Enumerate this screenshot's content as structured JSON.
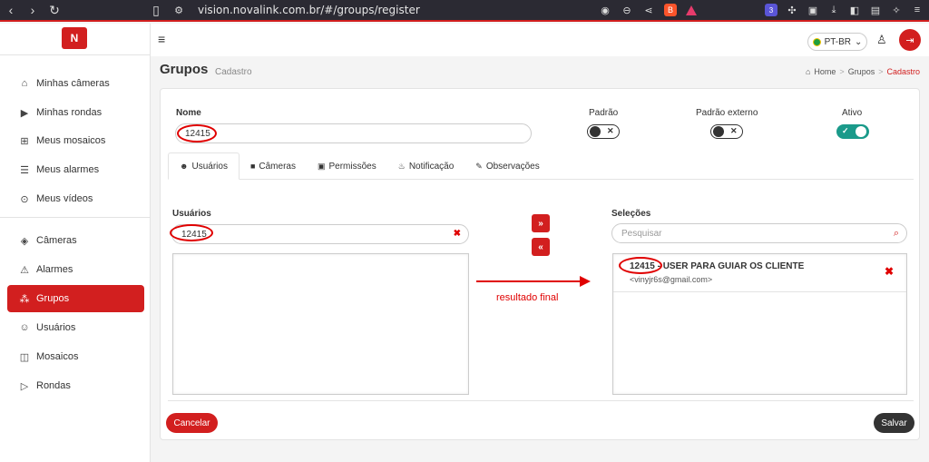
{
  "browser": {
    "url": "vision.novalink.com.br/#/groups/register",
    "ext_badge": "3"
  },
  "sidebar": {
    "logo_text": "N",
    "items": [
      {
        "label": "Minhas câmeras",
        "icon": "home-icon"
      },
      {
        "label": "Minhas rondas",
        "icon": "play-square-icon"
      },
      {
        "label": "Meus mosaicos",
        "icon": "grid-icon"
      },
      {
        "label": "Meus alarmes",
        "icon": "alarm-icon"
      },
      {
        "label": "Meus vídeos",
        "icon": "play-circle-icon"
      },
      {
        "label": "Câmeras",
        "icon": "camera-icon"
      },
      {
        "label": "Alarmes",
        "icon": "siren-icon"
      },
      {
        "label": "Grupos",
        "icon": "groups-icon",
        "active": true
      },
      {
        "label": "Usuários",
        "icon": "users-icon"
      },
      {
        "label": "Mosaicos",
        "icon": "mosaic-icon"
      },
      {
        "label": "Rondas",
        "icon": "rounds-icon"
      }
    ]
  },
  "header": {
    "language": "PT-BR"
  },
  "page": {
    "title": "Grupos",
    "subtitle": "Cadastro",
    "breadcrumb": [
      "Home",
      "Grupos",
      "Cadastro"
    ]
  },
  "form": {
    "name_label": "Nome",
    "name_value": "12415",
    "toggles": [
      {
        "label": "Padrão",
        "on": false
      },
      {
        "label": "Padrão externo",
        "on": false
      },
      {
        "label": "Ativo",
        "on": true
      }
    ]
  },
  "tabs": [
    {
      "label": "Usuários",
      "active": true
    },
    {
      "label": "Câmeras"
    },
    {
      "label": "Permissões"
    },
    {
      "label": "Notificação"
    },
    {
      "label": "Observações"
    }
  ],
  "users_panel": {
    "label": "Usuários",
    "search_value": "12415"
  },
  "move_buttons": {
    "add": "»",
    "remove": "«"
  },
  "selections_panel": {
    "label": "Seleções",
    "search_placeholder": "Pesquisar",
    "items": [
      {
        "title": "12415 - USER PARA GUIAR OS CLIENTE",
        "email": "<vinyjr6s@gmail.com>"
      }
    ]
  },
  "annotation": "resultado final",
  "buttons": {
    "cancel": "Cancelar",
    "save": "Salvar"
  },
  "colors": {
    "brand": "#d21f1f",
    "toggle_on": "#1a9a8a",
    "annotation": "#e00000"
  }
}
